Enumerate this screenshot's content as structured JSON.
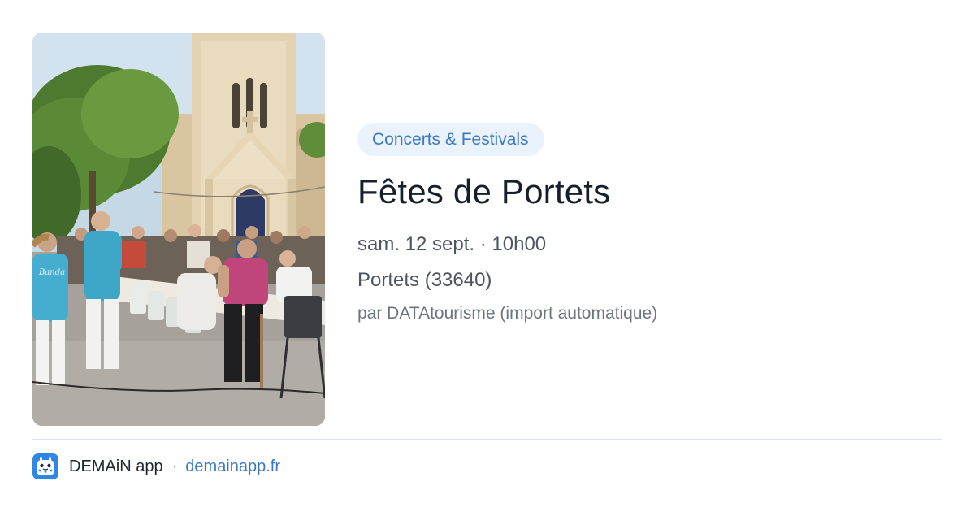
{
  "event": {
    "category": "Concerts & Festivals",
    "title": "Fêtes de Portets",
    "date": "sam. 12 sept. · 10h00",
    "location": "Portets (33640)",
    "source": "par DATAtourisme (import automatique)"
  },
  "footer": {
    "app_name": "DEMAiN app",
    "separator": "·",
    "link": "demainapp.fr"
  },
  "colors": {
    "accent": "#3a78c2",
    "badge_background": "#eaf2fb",
    "title": "#16202c",
    "secondary_text": "#4c5561",
    "muted_text": "#6c7480",
    "divider": "#dde3ea",
    "logo_blue": "#2f86e6"
  },
  "icons": {
    "app_logo": "demain-app-logo-icon"
  }
}
